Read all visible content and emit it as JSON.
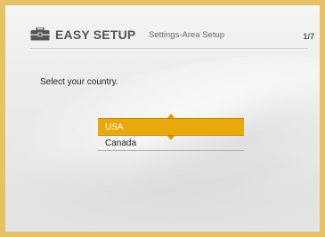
{
  "header": {
    "title": "EASY SETUP",
    "subtitle": "Settings-Area Setup",
    "page_indicator": "1/7",
    "icon": "toolbox-icon"
  },
  "main": {
    "prompt": "Select your country.",
    "options": [
      "USA",
      "Canada"
    ],
    "selected_index": 0
  },
  "colors": {
    "outer_border": "#e6c267",
    "highlight": "#e9a90a",
    "background": "#ececec"
  }
}
